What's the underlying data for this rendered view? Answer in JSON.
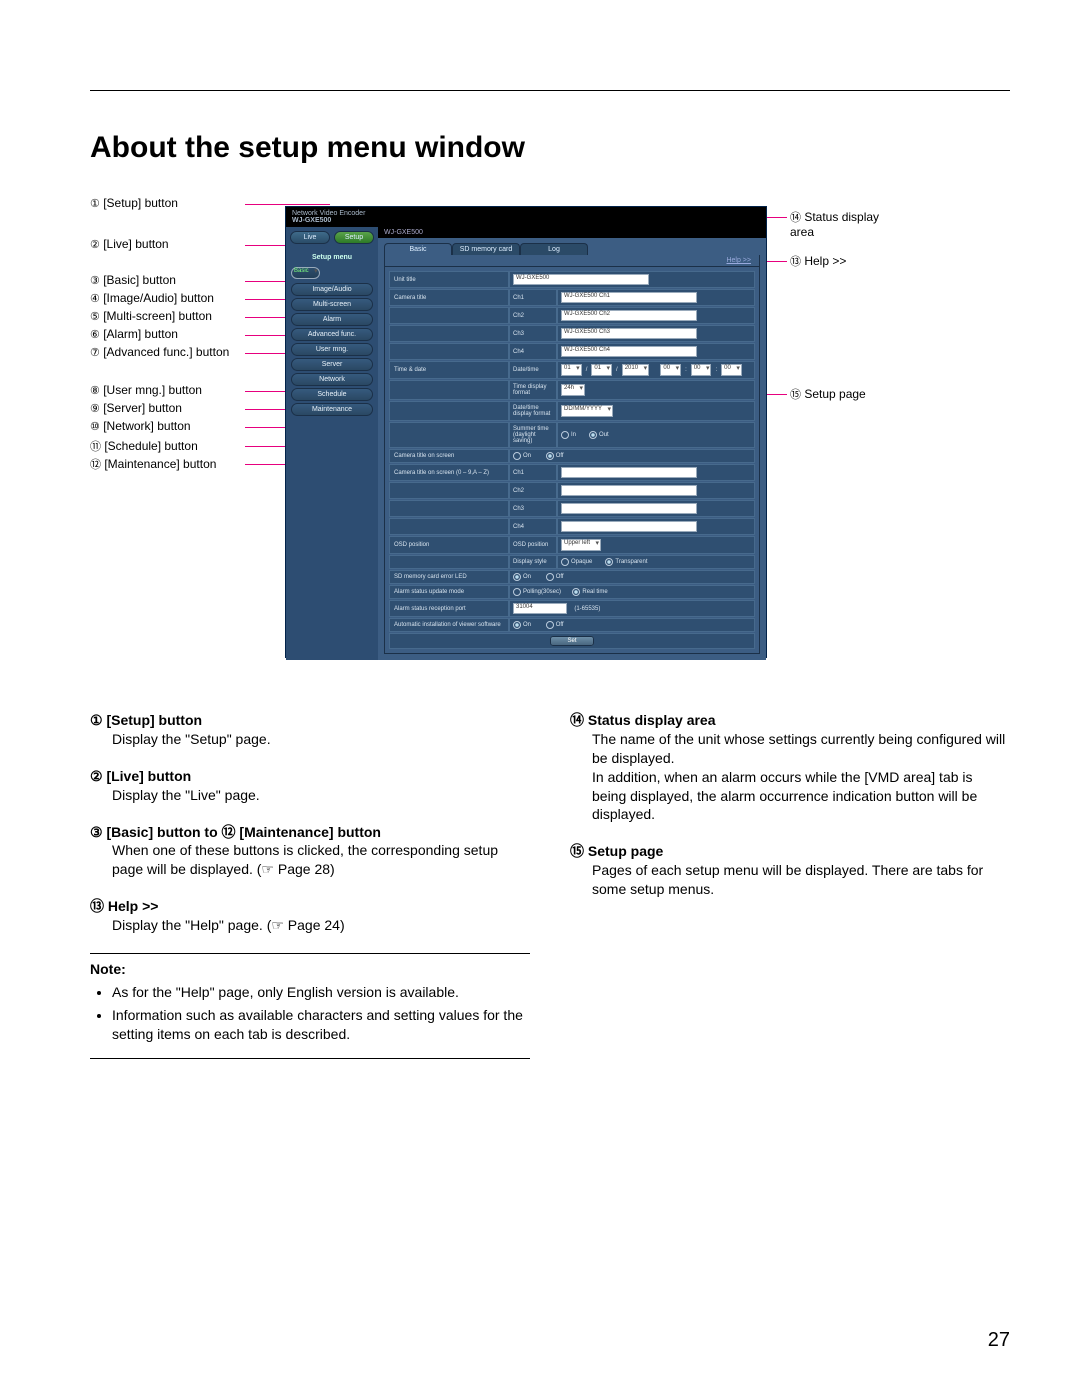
{
  "page": {
    "title": "About the setup menu window",
    "number": "27"
  },
  "diagram": {
    "left_callouts": [
      {
        "n": "①",
        "t": "[Setup] button"
      },
      {
        "n": "②",
        "t": "[Live] button"
      },
      {
        "n": "③",
        "t": "[Basic] button"
      },
      {
        "n": "④",
        "t": "[Image/Audio] button"
      },
      {
        "n": "⑤",
        "t": "[Multi-screen] button"
      },
      {
        "n": "⑥",
        "t": "[Alarm] button"
      },
      {
        "n": "⑦",
        "t": "[Advanced func.] button"
      },
      {
        "n": "⑧",
        "t": "[User mng.] button"
      },
      {
        "n": "⑨",
        "t": "[Server] button"
      },
      {
        "n": "⑩",
        "t": "[Network] button"
      },
      {
        "n": "⑪",
        "t": "[Schedule] button"
      },
      {
        "n": "⑫",
        "t": "[Maintenance] button"
      }
    ],
    "right_callouts": [
      {
        "n": "⑭",
        "t": "Status display\narea"
      },
      {
        "n": "⑬",
        "t": "Help >>"
      },
      {
        "n": "⑮",
        "t": "Setup page"
      }
    ]
  },
  "app": {
    "product_header": "Network Video Encoder",
    "model": "WJ-GXE500",
    "status": "WJ-GXE500",
    "buttons": {
      "live": "Live",
      "setup": "Setup"
    },
    "menu_title": "Setup menu",
    "menu": [
      "Basic",
      "Image/Audio",
      "Multi-screen",
      "Alarm",
      "Advanced func.",
      "User mng.",
      "Server",
      "Network",
      "Schedule",
      "Maintenance"
    ],
    "tabs": [
      "Basic",
      "SD memory card",
      "Log"
    ],
    "help": "Help >>",
    "form": {
      "unit_title": {
        "label": "Unit title",
        "value": "WJ-GXE500"
      },
      "camera_title": {
        "label": "Camera title",
        "ch": [
          {
            "c": "Ch1",
            "v": "WJ-GXE500 Ch1"
          },
          {
            "c": "Ch2",
            "v": "WJ-GXE500 Ch2"
          },
          {
            "c": "Ch3",
            "v": "WJ-GXE500 Ch3"
          },
          {
            "c": "Ch4",
            "v": "WJ-GXE500 Ch4"
          }
        ]
      },
      "time_date": {
        "label": "Time & date",
        "date_time": {
          "l": "Date/time",
          "d1": "01",
          "d2": "01",
          "d3": "2010",
          "t1": "00",
          "t2": "00",
          "t3": "00"
        },
        "time_fmt": {
          "l": "Time display format",
          "v": "24h"
        },
        "date_fmt": {
          "l": "Date/time display format",
          "v": "DD/MM/YYYY"
        },
        "summer": {
          "l": "Summer time (daylight saving)",
          "o1": "In",
          "o2": "Out"
        }
      },
      "cam_on_screen": {
        "label": "Camera title on screen",
        "o1": "On",
        "o2": "Off"
      },
      "cam_on_screen_chars": {
        "label": "Camera title on screen (0 – 9,A – Z)",
        "ch": [
          "Ch1",
          "Ch2",
          "Ch3",
          "Ch4"
        ]
      },
      "osd": {
        "label": "OSD position",
        "pos": {
          "l": "OSD position",
          "v": "Upper left"
        },
        "style": {
          "l": "Display style",
          "o1": "Opaque",
          "o2": "Transparent"
        }
      },
      "sd_led": {
        "label": "SD memory card error LED",
        "o1": "On",
        "o2": "Off"
      },
      "alarm_mode": {
        "label": "Alarm status update mode",
        "o1": "Polling(30sec)",
        "o2": "Real time"
      },
      "alarm_port": {
        "label": "Alarm status reception port",
        "v": "31004",
        "range": "(1-65535)"
      },
      "auto_install": {
        "label": "Automatic installation of viewer software",
        "o1": "On",
        "o2": "Off"
      },
      "set": "Set"
    }
  },
  "descriptions": {
    "left": [
      {
        "n": "①",
        "hd": "[Setup] button",
        "bd": "Display the \"Setup\" page."
      },
      {
        "n": "②",
        "hd": "[Live] button",
        "bd": "Display the \"Live\" page."
      },
      {
        "n": "③",
        "hd": "[Basic] button to ⑫ [Maintenance] button",
        "bd": "When one of these buttons is clicked, the corresponding setup page will be displayed. (☞ Page 28)"
      },
      {
        "n": "⑬",
        "hd": "Help >>",
        "bd": "Display the \"Help\" page. (☞ Page 24)"
      }
    ],
    "note": {
      "hd": "Note:",
      "items": [
        "As for the \"Help\" page, only English version is available.",
        "Information such as available characters and setting values for the setting items on each tab is described."
      ]
    },
    "right": [
      {
        "n": "⑭",
        "hd": "Status display area",
        "bd": "The name of the unit whose settings currently being configured will be displayed.\nIn addition, when an alarm occurs while the [VMD area] tab is being displayed, the alarm occurrence indication button will be displayed."
      },
      {
        "n": "⑮",
        "hd": "Setup page",
        "bd": "Pages of each setup menu will be displayed. There are tabs for some setup menus."
      }
    ]
  }
}
